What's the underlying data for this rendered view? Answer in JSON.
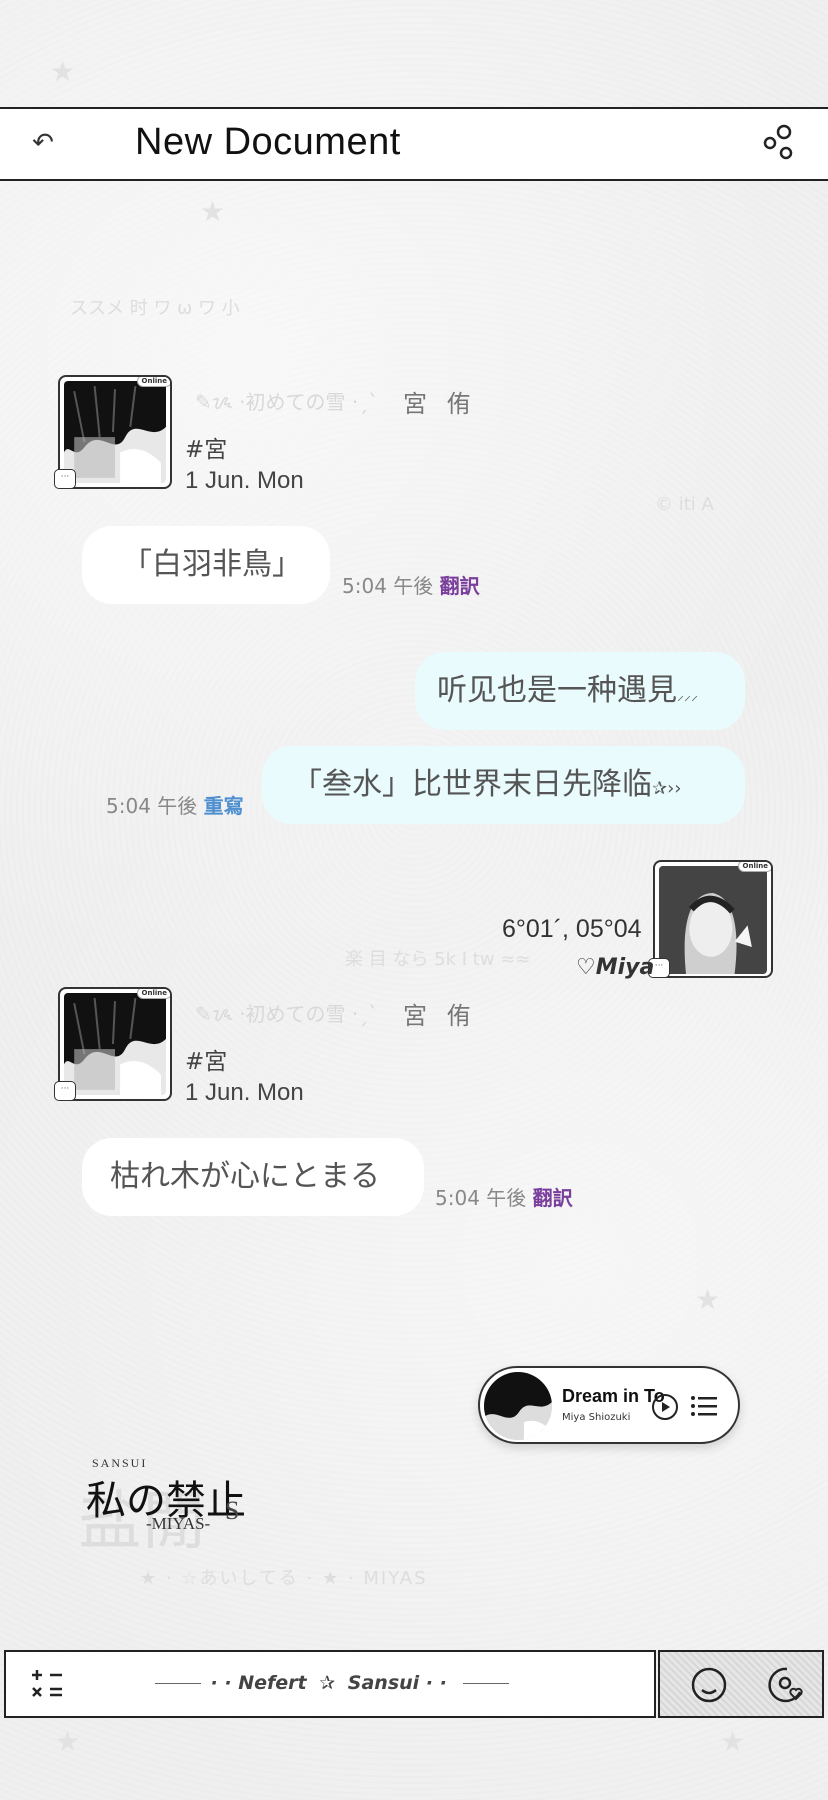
{
  "header": {
    "title": "New Document"
  },
  "faint_texts": {
    "top": "ススメ 时 ワ ω ワ 小",
    "mid_right": "© iti A",
    "mid": "楽 目 なら 5k I tw ≈≈"
  },
  "messages": [
    {
      "profile": {
        "faint_prefix": "✎ᝰ ·初めての雪 ·ˏˋ",
        "name": "宮 侑",
        "tag": "#宮",
        "date": "1 Jun. Mon",
        "online": "Online"
      },
      "bubble": "「白羽非鳥」",
      "time": "5:04 午後",
      "action": "翻訳"
    },
    {
      "bubble": "听见也是一种遇見",
      "suffix": "⸝⸝⸝"
    },
    {
      "bubble": "「叁水」比世界末日先降临",
      "suffix": "✰››",
      "time": "5:04 午後",
      "action": "重寫"
    },
    {
      "coords": "6°01´, 05°04",
      "signature": "♡Miya",
      "online": "Online"
    },
    {
      "profile": {
        "faint_prefix": "✎ᝰ ·初めての雪 ·ˏˋ",
        "name": "宮 侑",
        "tag": "#宮",
        "date": "1 Jun. Mon",
        "online": "Online"
      },
      "bubble": "枯れ木が心にとまる",
      "time": "5:04 午後",
      "action": "翻訳"
    }
  ],
  "player": {
    "title": "Dream in To",
    "artist": "Miya Shiozuki"
  },
  "logo": {
    "top": "SANSUI",
    "main": "私の禁止",
    "sub": "-MIYAS-",
    "letter": "S",
    "faint_line": "★ · ☆あいしてる · ★ · MIYAS"
  },
  "bottom_bar": {
    "left": "Nefert",
    "star": "✰",
    "right": "Sansui",
    "calc_icon": "calculator-icon",
    "emoji_icon": "smile-icon",
    "settings_icon": "settings-heart-icon"
  }
}
